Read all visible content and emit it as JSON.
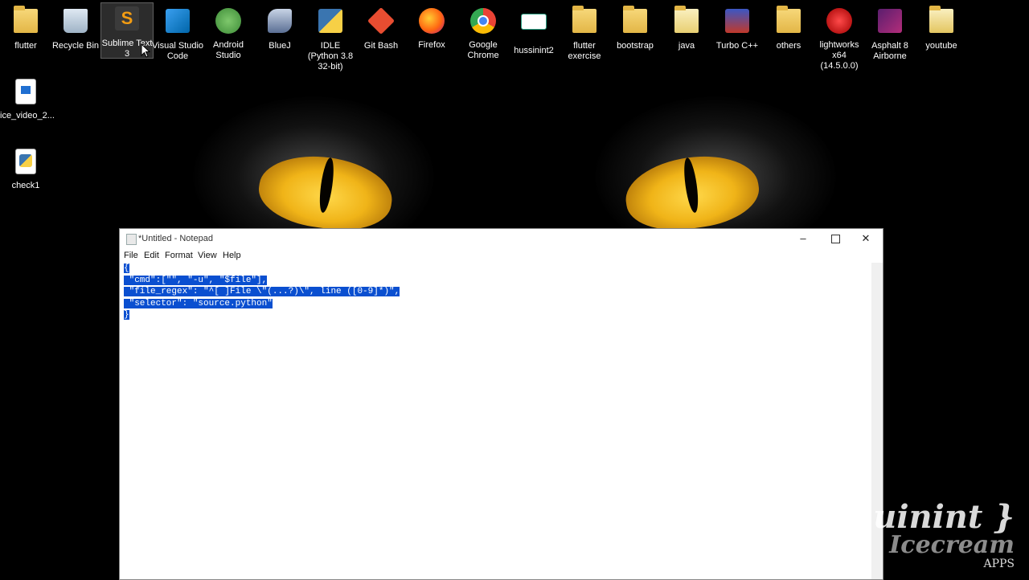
{
  "desktop": {
    "icons": [
      {
        "label": "flutter",
        "icon": "folder-icon"
      },
      {
        "label": "Recycle Bin",
        "icon": "recycle-bin-icon"
      },
      {
        "label": "Sublime Text 3",
        "icon": "sublime-text-icon"
      },
      {
        "label": "Visual Studio Code",
        "icon": "vscode-icon"
      },
      {
        "label": "Android Studio",
        "icon": "android-studio-icon"
      },
      {
        "label": "BlueJ",
        "icon": "bluej-icon"
      },
      {
        "label": "IDLE (Python 3.8 32-bit)",
        "icon": "python-idle-icon"
      },
      {
        "label": "Git Bash",
        "icon": "git-bash-icon"
      },
      {
        "label": "Firefox",
        "icon": "firefox-icon"
      },
      {
        "label": "Google Chrome",
        "icon": "chrome-icon"
      },
      {
        "label": "hussinint2",
        "icon": "hussinint-icon"
      },
      {
        "label": "flutter exercise",
        "icon": "folder-icon"
      },
      {
        "label": "bootstrap",
        "icon": "folder-icon"
      },
      {
        "label": "java",
        "icon": "folder-icon"
      },
      {
        "label": "Turbo C++",
        "icon": "turbo-cpp-icon"
      },
      {
        "label": "others",
        "icon": "folder-icon"
      },
      {
        "label": "lightworks x64 (14.5.0.0)",
        "icon": "lightworks-icon"
      },
      {
        "label": "Asphalt 8 Airborne",
        "icon": "asphalt-icon"
      },
      {
        "label": "youtube",
        "icon": "folder-icon"
      },
      {
        "label": "ice_video_2...",
        "icon": "video-file-icon"
      },
      {
        "label": "check1",
        "icon": "python-file-icon"
      }
    ]
  },
  "notepad": {
    "title": "*Untitled - Notepad",
    "menu": [
      "File",
      "Edit",
      "Format",
      "View",
      "Help"
    ],
    "lines": [
      "{",
      " \"cmd\":[\"\", \"-u\", \"$file\"],",
      " \"file_regex\": \"^[ ]File \\\"(...?)\\\", line ([0-9]*)\",",
      " \"selector\": \"source.python\"",
      "}"
    ],
    "selection_color": "#0a4fd0"
  },
  "watermark": {
    "line1": "uinint }",
    "line2": "Icecream",
    "line3": "APPS"
  }
}
